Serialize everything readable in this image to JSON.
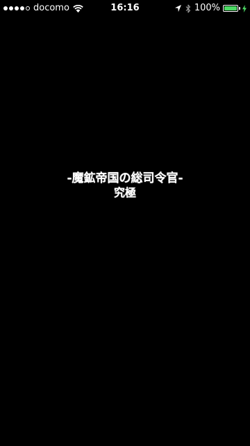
{
  "status_bar": {
    "signal_bars": [
      true,
      true,
      true,
      true,
      false
    ],
    "carrier": "docomo",
    "time": "16:16",
    "battery_percent": "100%",
    "battery_level": 1.0,
    "battery_color": "#4cd964",
    "icons": [
      "signal-dots-icon",
      "wifi-icon",
      "location-arrow-icon",
      "bluetooth-icon",
      "battery-icon",
      "charging-bolt-icon"
    ]
  },
  "main": {
    "title": "-魔鉱帝国の総司令官-",
    "subtitle": "究極"
  }
}
